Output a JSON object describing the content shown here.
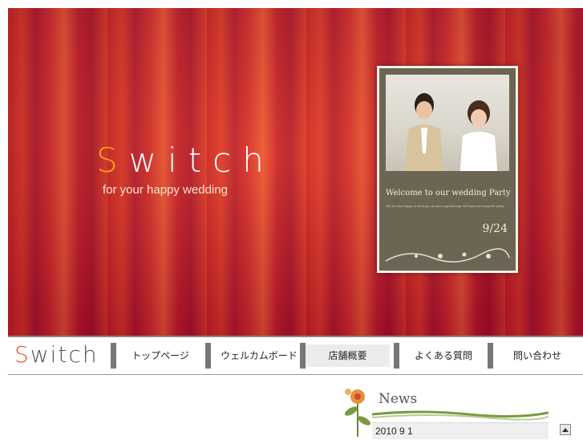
{
  "hero": {
    "title_first": "S",
    "title_rest": "witch",
    "subtitle": "for your happy wedding"
  },
  "card": {
    "welcome": "Welcome to our wedding Party",
    "small_text": "We are very happy to meet you at such a special day. We hope you enjoy the party.",
    "date": "9/24"
  },
  "nav": {
    "logo_first": "S",
    "logo_rest": "witch",
    "items": [
      {
        "label": "トップページ"
      },
      {
        "label": "ウェルカムボード"
      },
      {
        "label": "店舗概要"
      },
      {
        "label": "よくある質問"
      },
      {
        "label": "問い合わせ"
      }
    ],
    "active_index": 2
  },
  "news": {
    "title": "News",
    "date": "2010 9 1"
  },
  "colors": {
    "accent_orange": "#f6a020",
    "logo_orange": "#e8501e",
    "card_bg": "#6d6553"
  },
  "icons": {
    "scroll_up": "triangle-up-icon",
    "news_flower": "flower-icon"
  }
}
